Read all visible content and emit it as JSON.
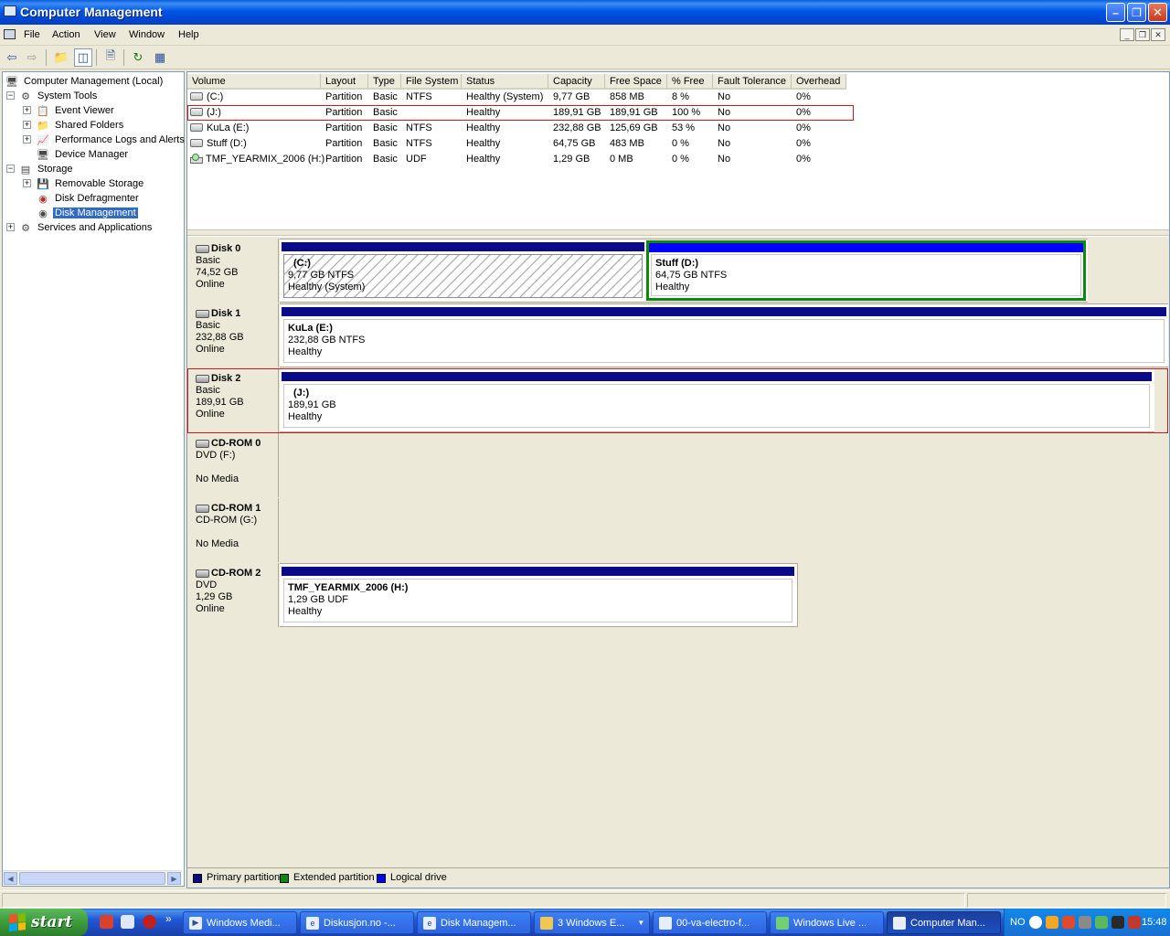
{
  "window": {
    "title": "Computer Management",
    "minimize_glyph": "–",
    "maximize_glyph": "❐",
    "close_glyph": "✕"
  },
  "menu": [
    "File",
    "Action",
    "View",
    "Window",
    "Help"
  ],
  "tree": {
    "root": "Computer Management (Local)",
    "system_tools": "System Tools",
    "event_viewer": "Event Viewer",
    "shared_folders": "Shared Folders",
    "perf_logs": "Performance Logs and Alerts",
    "device_manager": "Device Manager",
    "storage": "Storage",
    "removable_storage": "Removable Storage",
    "disk_defragmenter": "Disk Defragmenter",
    "disk_management": "Disk Management",
    "services_apps": "Services and Applications"
  },
  "volume_columns": [
    "Volume",
    "Layout",
    "Type",
    "File System",
    "Status",
    "Capacity",
    "Free Space",
    "% Free",
    "Fault Tolerance",
    "Overhead"
  ],
  "volumes": [
    {
      "name": "(C:)",
      "layout": "Partition",
      "type": "Basic",
      "fs": "NTFS",
      "status": "Healthy (System)",
      "capacity": "9,77 GB",
      "free": "858 MB",
      "pct": "8 %",
      "fault": "No",
      "overhead": "0%"
    },
    {
      "name": "(J:)",
      "layout": "Partition",
      "type": "Basic",
      "fs": "",
      "status": "Healthy",
      "capacity": "189,91 GB",
      "free": "189,91 GB",
      "pct": "100 %",
      "fault": "No",
      "overhead": "0%"
    },
    {
      "name": "KuLa (E:)",
      "layout": "Partition",
      "type": "Basic",
      "fs": "NTFS",
      "status": "Healthy",
      "capacity": "232,88 GB",
      "free": "125,69 GB",
      "pct": "53 %",
      "fault": "No",
      "overhead": "0%"
    },
    {
      "name": "Stuff (D:)",
      "layout": "Partition",
      "type": "Basic",
      "fs": "NTFS",
      "status": "Healthy",
      "capacity": "64,75 GB",
      "free": "483 MB",
      "pct": "0 %",
      "fault": "No",
      "overhead": "0%"
    },
    {
      "name": "TMF_YEARMIX_2006 (H:)",
      "layout": "Partition",
      "type": "Basic",
      "fs": "UDF",
      "status": "Healthy",
      "capacity": "1,29 GB",
      "free": "0 MB",
      "pct": "0 %",
      "fault": "No",
      "overhead": "0%"
    }
  ],
  "disks": {
    "disk0": {
      "name": "Disk 0",
      "kind": "Basic",
      "size": "74,52 GB",
      "state": "Online"
    },
    "disk1": {
      "name": "Disk 1",
      "kind": "Basic",
      "size": "232,88 GB",
      "state": "Online"
    },
    "disk2": {
      "name": "Disk 2",
      "kind": "Basic",
      "size": "189,91 GB",
      "state": "Online"
    },
    "cdrom0": {
      "name": "CD-ROM 0",
      "kind": "DVD (F:)",
      "state": "No Media"
    },
    "cdrom1": {
      "name": "CD-ROM 1",
      "kind": "CD-ROM (G:)",
      "state": "No Media"
    },
    "cdrom2": {
      "name": "CD-ROM 2",
      "kind": "DVD",
      "size": "1,29 GB",
      "state": "Online"
    }
  },
  "partitions": {
    "c": {
      "name": "(C:)",
      "size": "9,77 GB NTFS",
      "status": "Healthy (System)"
    },
    "d": {
      "name": "Stuff  (D:)",
      "size": "64,75 GB NTFS",
      "status": "Healthy"
    },
    "e": {
      "name": "KuLa  (E:)",
      "size": "232,88 GB NTFS",
      "status": "Healthy"
    },
    "j": {
      "name": "(J:)",
      "size": "189,91 GB",
      "status": "Healthy"
    },
    "h": {
      "name": "TMF_YEARMIX_2006  (H:)",
      "size": "1,29 GB UDF",
      "status": "Healthy"
    }
  },
  "legend": {
    "primary": "Primary partition",
    "extended": "Extended partition",
    "logical": "Logical drive",
    "primary_color": "#0a0a88",
    "extended_color": "#0b8a0b",
    "logical_color": "#0000ff"
  },
  "taskbar": {
    "start": "start",
    "overflow": "»",
    "buttons": [
      "Windows Medi...",
      "Diskusjon.no -...",
      "Disk Managem...",
      "3 Windows E...",
      "00-va-electro-f...",
      "Windows Live ...",
      "Computer Man..."
    ],
    "tray_lang": "NO",
    "clock": "15:48"
  }
}
